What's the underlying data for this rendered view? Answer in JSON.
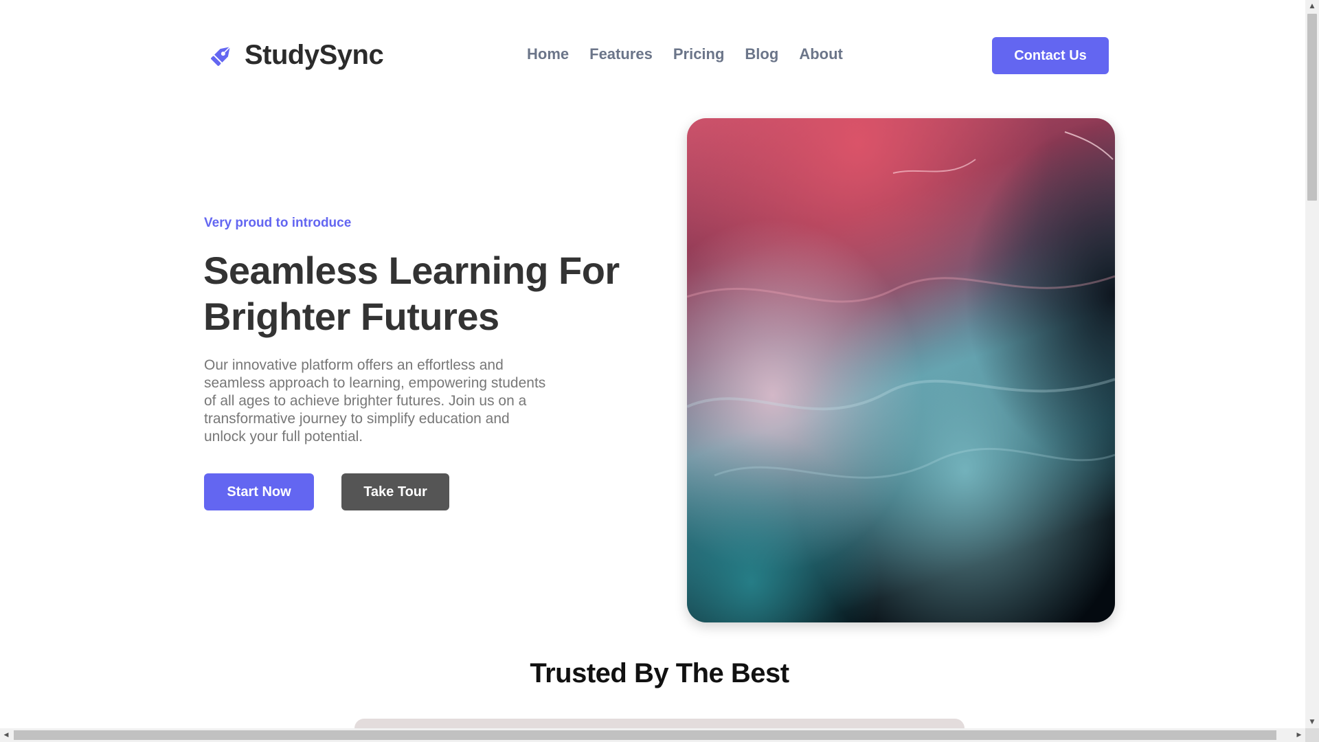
{
  "header": {
    "brand_name": "StudySync",
    "brand_icon": "fountain-pen-icon",
    "nav": [
      {
        "label": "Home"
      },
      {
        "label": "Features"
      },
      {
        "label": "Pricing"
      },
      {
        "label": "Blog"
      },
      {
        "label": "About"
      }
    ],
    "contact_label": "Contact Us"
  },
  "hero": {
    "eyebrow": "Very proud to introduce",
    "title_line1": "Seamless Learning For",
    "title_line2": "Brighter Futures",
    "description": "Our innovative platform offers an effortless and seamless approach to learning, empowering students of all ages to achieve brighter futures. Join us on a transformative journey to simplify education and unlock your full potential.",
    "primary_cta": "Start Now",
    "secondary_cta": "Take Tour"
  },
  "trusted": {
    "title": "Trusted By The Best"
  },
  "colors": {
    "accent": "#6366f1",
    "secondary_button": "#555555",
    "nav_text": "#6b7589",
    "heading": "#333333",
    "body_text": "#777777"
  },
  "scrollbars": {
    "vertical_scroll_fraction": 0.0,
    "horizontal_scroll_fraction": 0.0
  }
}
